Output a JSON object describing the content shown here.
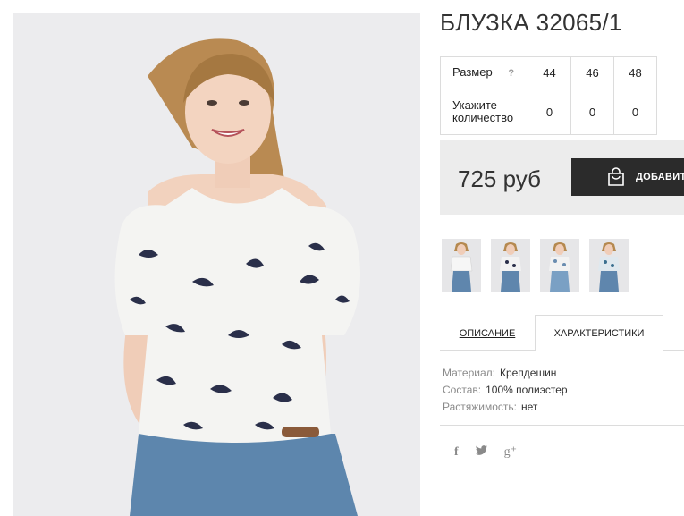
{
  "product": {
    "title": "БЛУЗКА 32065/1"
  },
  "size_table": {
    "size_label": "Размер",
    "help_icon": "?",
    "sizes": [
      "44",
      "46",
      "48"
    ],
    "qty_label": "Укажите количество",
    "quantities": [
      "0",
      "0",
      "0"
    ]
  },
  "price": {
    "value": "725 руб",
    "add_button_label": "ДОБАВИТЬ"
  },
  "tabs": {
    "description": "ОПИСАНИЕ",
    "characteristics": "ХАРАКТЕРИСТИКИ"
  },
  "specs": [
    {
      "key": "Материал:",
      "value": "Крепдешин"
    },
    {
      "key": "Состав:",
      "value": "100% полиэстер"
    },
    {
      "key": "Растяжимость:",
      "value": "нет"
    }
  ],
  "social": {
    "facebook": "f",
    "twitter_icon": "twitter-icon",
    "googleplus": "g⁺"
  },
  "colors": {
    "button_bg": "#2b2b2b",
    "price_box_bg": "#ececec",
    "photo_bg": "#ececee",
    "blouse_print": "#2a2f4a"
  }
}
